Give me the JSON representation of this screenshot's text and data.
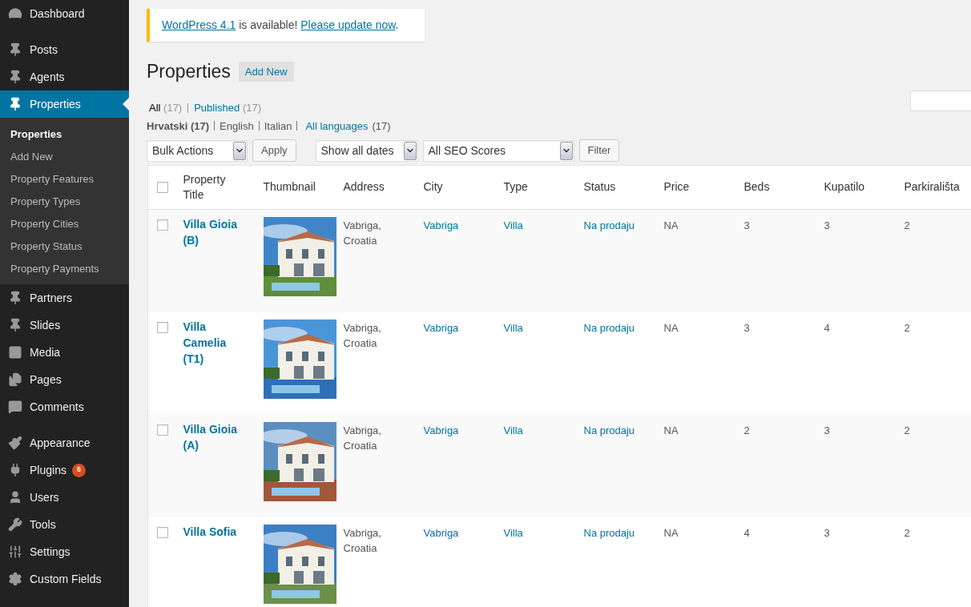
{
  "sidebar": {
    "groups": [
      {
        "items": [
          {
            "label": "Dashboard",
            "selected": false
          }
        ]
      },
      {
        "items": [
          {
            "label": "Posts",
            "selected": false
          },
          {
            "label": "Agents",
            "selected": false
          },
          {
            "label": "Properties",
            "selected": true,
            "children": [
              {
                "label": "Properties",
                "selected": true
              },
              {
                "label": "Add New",
                "selected": false
              },
              {
                "label": "Property Features",
                "selected": false
              },
              {
                "label": "Property Types",
                "selected": false
              },
              {
                "label": "Property Cities",
                "selected": false
              },
              {
                "label": "Property Status",
                "selected": false
              },
              {
                "label": "Property Payments",
                "selected": false
              }
            ]
          },
          {
            "label": "Partners",
            "selected": false
          },
          {
            "label": "Slides",
            "selected": false
          },
          {
            "label": "Media",
            "selected": false
          },
          {
            "label": "Pages",
            "selected": false
          },
          {
            "label": "Comments",
            "selected": false
          }
        ]
      },
      {
        "items": [
          {
            "label": "Appearance",
            "selected": false
          },
          {
            "label": "Plugins",
            "selected": false,
            "badge": "5"
          },
          {
            "label": "Users",
            "selected": false
          },
          {
            "label": "Tools",
            "selected": false
          },
          {
            "label": "Settings",
            "selected": false
          },
          {
            "label": "Custom Fields",
            "selected": false
          }
        ]
      }
    ]
  },
  "notice": {
    "parts": [
      {
        "kind": "link",
        "text": "WordPress 4.1"
      },
      {
        "kind": "text",
        "text": " is available! "
      },
      {
        "kind": "link",
        "text": "Please update now"
      },
      {
        "kind": "text",
        "text": "."
      }
    ]
  },
  "page_title": "Properties",
  "add_new_button": "Add New",
  "status_filters": [
    {
      "label": "All",
      "count": "(17)",
      "selected": true
    },
    {
      "label": "Published",
      "count": "(17)",
      "selected": false
    }
  ],
  "language_filters": [
    {
      "label": "Hrvatski",
      "count": "(17)",
      "kind": "current"
    },
    {
      "label": "English",
      "kind": "plain"
    },
    {
      "label": "Italian",
      "kind": "plain"
    },
    {
      "label": "All languages",
      "count": "(17)",
      "kind": "link"
    }
  ],
  "bulk_actions": {
    "value": "Bulk Actions"
  },
  "apply_button": "Apply",
  "date_filter": {
    "value": "Show all dates"
  },
  "seo_filter": {
    "value": "All SEO Scores"
  },
  "filter_button": "Filter",
  "table": {
    "header_checkbox": {
      "checked": false
    },
    "columns": [
      "Property Title",
      "Thumbnail",
      "Address",
      "City",
      "Type",
      "Status",
      "Price",
      "Beds",
      "Kupatilo",
      "Parkirališta"
    ],
    "rows": [
      {
        "checked": false,
        "title": "Villa Gioia (B)",
        "address": "Vabriga, Croatia",
        "city": "Vabriga",
        "type": "Villa",
        "status": "Na prodaju",
        "price": "NA",
        "beds": "3",
        "kupatilo": "3",
        "parkiralista": "2"
      },
      {
        "checked": false,
        "title": "Villa Camelia (T1)",
        "address": "Vabriga, Croatia",
        "city": "Vabriga",
        "type": "Villa",
        "status": "Na prodaju",
        "price": "NA",
        "beds": "3",
        "kupatilo": "4",
        "parkiralista": "2"
      },
      {
        "checked": false,
        "title": "Villa Gioia (A)",
        "address": "Vabriga, Croatia",
        "city": "Vabriga",
        "type": "Villa",
        "status": "Na prodaju",
        "price": "NA",
        "beds": "2",
        "kupatilo": "3",
        "parkiralista": "2"
      },
      {
        "checked": false,
        "title": "Villa Sofia",
        "address": "Vabriga, Croatia",
        "city": "Vabriga",
        "type": "Villa",
        "status": "Na prodaju",
        "price": "NA",
        "beds": "4",
        "kupatilo": "3",
        "parkiralista": "2"
      }
    ]
  }
}
